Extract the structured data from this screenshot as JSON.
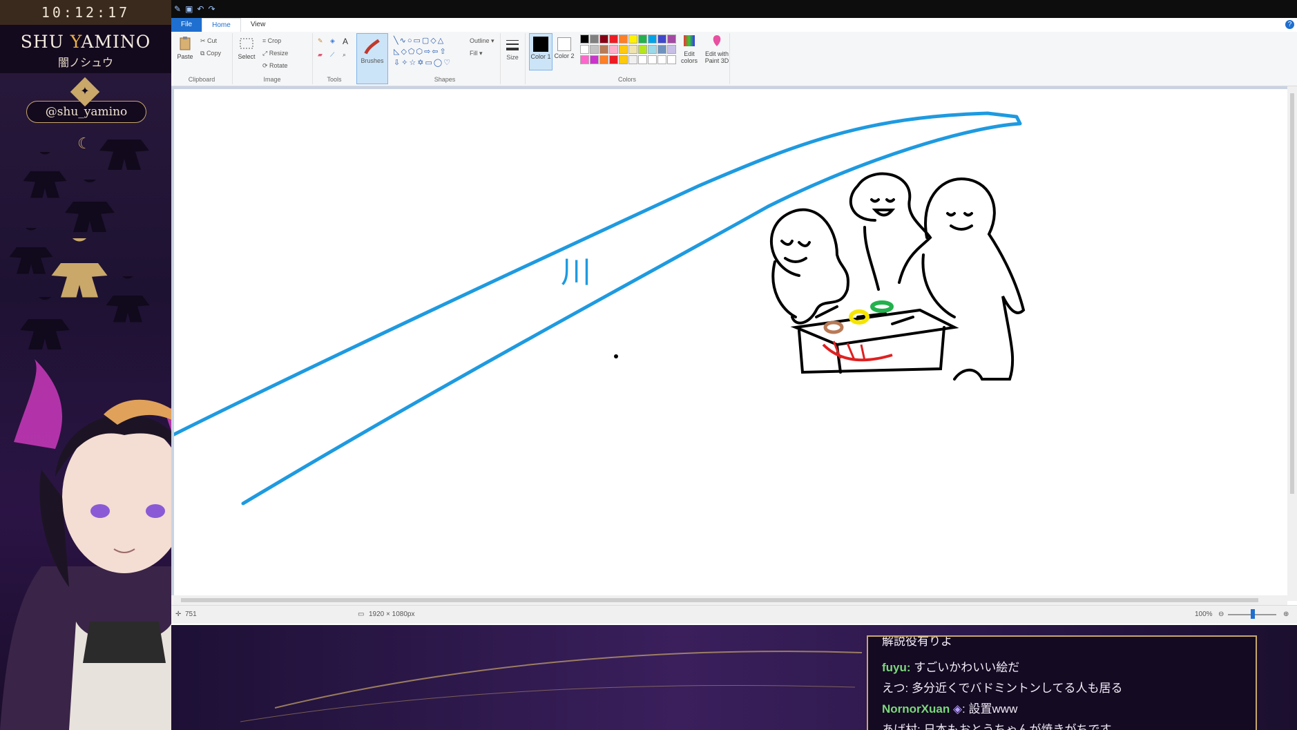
{
  "overlay": {
    "clock": "10:12:17",
    "name_en_prefix": "SHU ",
    "name_en_y": "Y",
    "name_en_rest": "AMINO",
    "name_jp": "闇ノシュウ",
    "handle": "@shu_yamino"
  },
  "paint": {
    "menu": {
      "file": "File",
      "home": "Home",
      "view": "View"
    },
    "ribbon": {
      "clipboard": {
        "paste": "Paste",
        "cut": "Cut",
        "copy": "Copy",
        "label": "Clipboard"
      },
      "image": {
        "select": "Select",
        "crop": "Crop",
        "resize": "Resize",
        "rotate": "Rotate",
        "label": "Image"
      },
      "tools": {
        "label": "Tools"
      },
      "brushes": {
        "label": "Brushes"
      },
      "shapes": {
        "outline": "Outline",
        "fill": "Fill",
        "label": "Shapes"
      },
      "size": {
        "label": "Size"
      },
      "colors": {
        "color1": "Color 1",
        "color2": "Color 2",
        "edit_colors": "Edit colors",
        "edit_paint3d": "Edit with Paint 3D",
        "label": "Colors",
        "row1": [
          "#000000",
          "#7f7f7f",
          "#880015",
          "#ed1c24",
          "#ff7f27",
          "#fff200",
          "#22b14c",
          "#00a2e8",
          "#3f48cc",
          "#a349a4"
        ],
        "row2": [
          "#ffffff",
          "#c3c3c3",
          "#b97a57",
          "#ffaec9",
          "#ffc90e",
          "#efe4b0",
          "#b5e61d",
          "#99d9ea",
          "#7092be",
          "#c8bfe7"
        ],
        "row3": [
          "#ff66cc",
          "#cc33cc",
          "#ff7f27",
          "#ed1c24",
          "#ffc90e",
          "#f0f0f0",
          "#ffffff",
          "#ffffff",
          "#ffffff",
          "#ffffff"
        ]
      }
    },
    "canvas_text": "川",
    "status": {
      "cursor_pos": "751",
      "dimensions": "1920 × 1080px",
      "zoom": "100%"
    }
  },
  "chat": {
    "messages": [
      {
        "user": "",
        "text": "解説役有りよ"
      },
      {
        "user": "fuyu",
        "text": "すごいかわいい絵だ"
      },
      {
        "user": "えつ",
        "text": "多分近くでバドミントンしてる人も居る"
      },
      {
        "user": "NornorXuan",
        "text": "設置www"
      },
      {
        "user": "あげ村",
        "text": "日本もおとうちゃんが焼きがちです"
      }
    ]
  }
}
